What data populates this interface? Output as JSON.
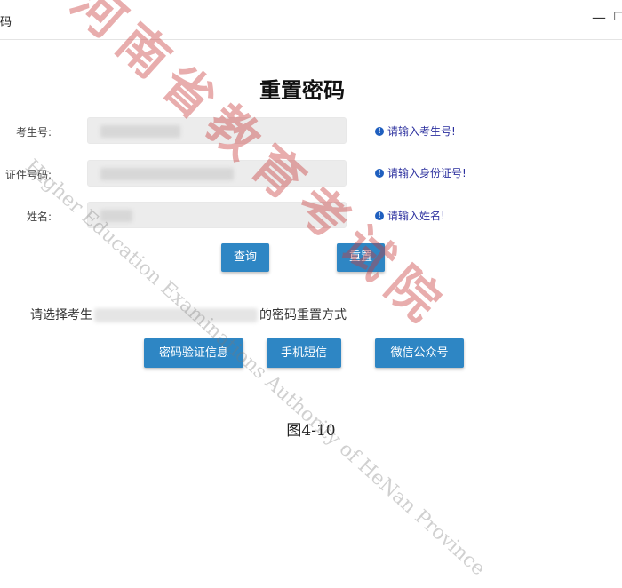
{
  "window": {
    "title": "码",
    "minimize_glyph": "—",
    "maximize_glyph": "☐"
  },
  "page_title": "重置密码",
  "form": {
    "exam_no_label": "考生号:",
    "id_no_label": "证件号码:",
    "name_label": "姓名:",
    "exam_no_hint": "请输入考生号!",
    "id_no_hint": "请输入身份证号!",
    "name_hint": "请输入姓名!",
    "hint_icon": "info-icon"
  },
  "buttons": {
    "query": "查询",
    "reset": "重置"
  },
  "reset_method": {
    "prefix": "请选择考生",
    "suffix": "的密码重置方式",
    "options": [
      "密码验证信息",
      "手机短信",
      "微信公众号"
    ]
  },
  "caption": "图4-10",
  "watermark": {
    "text_en": "Higher Education Examinations Authority of HeNan Province",
    "text_cn": "河南省教育考试院",
    "color": "#c83c3c"
  }
}
